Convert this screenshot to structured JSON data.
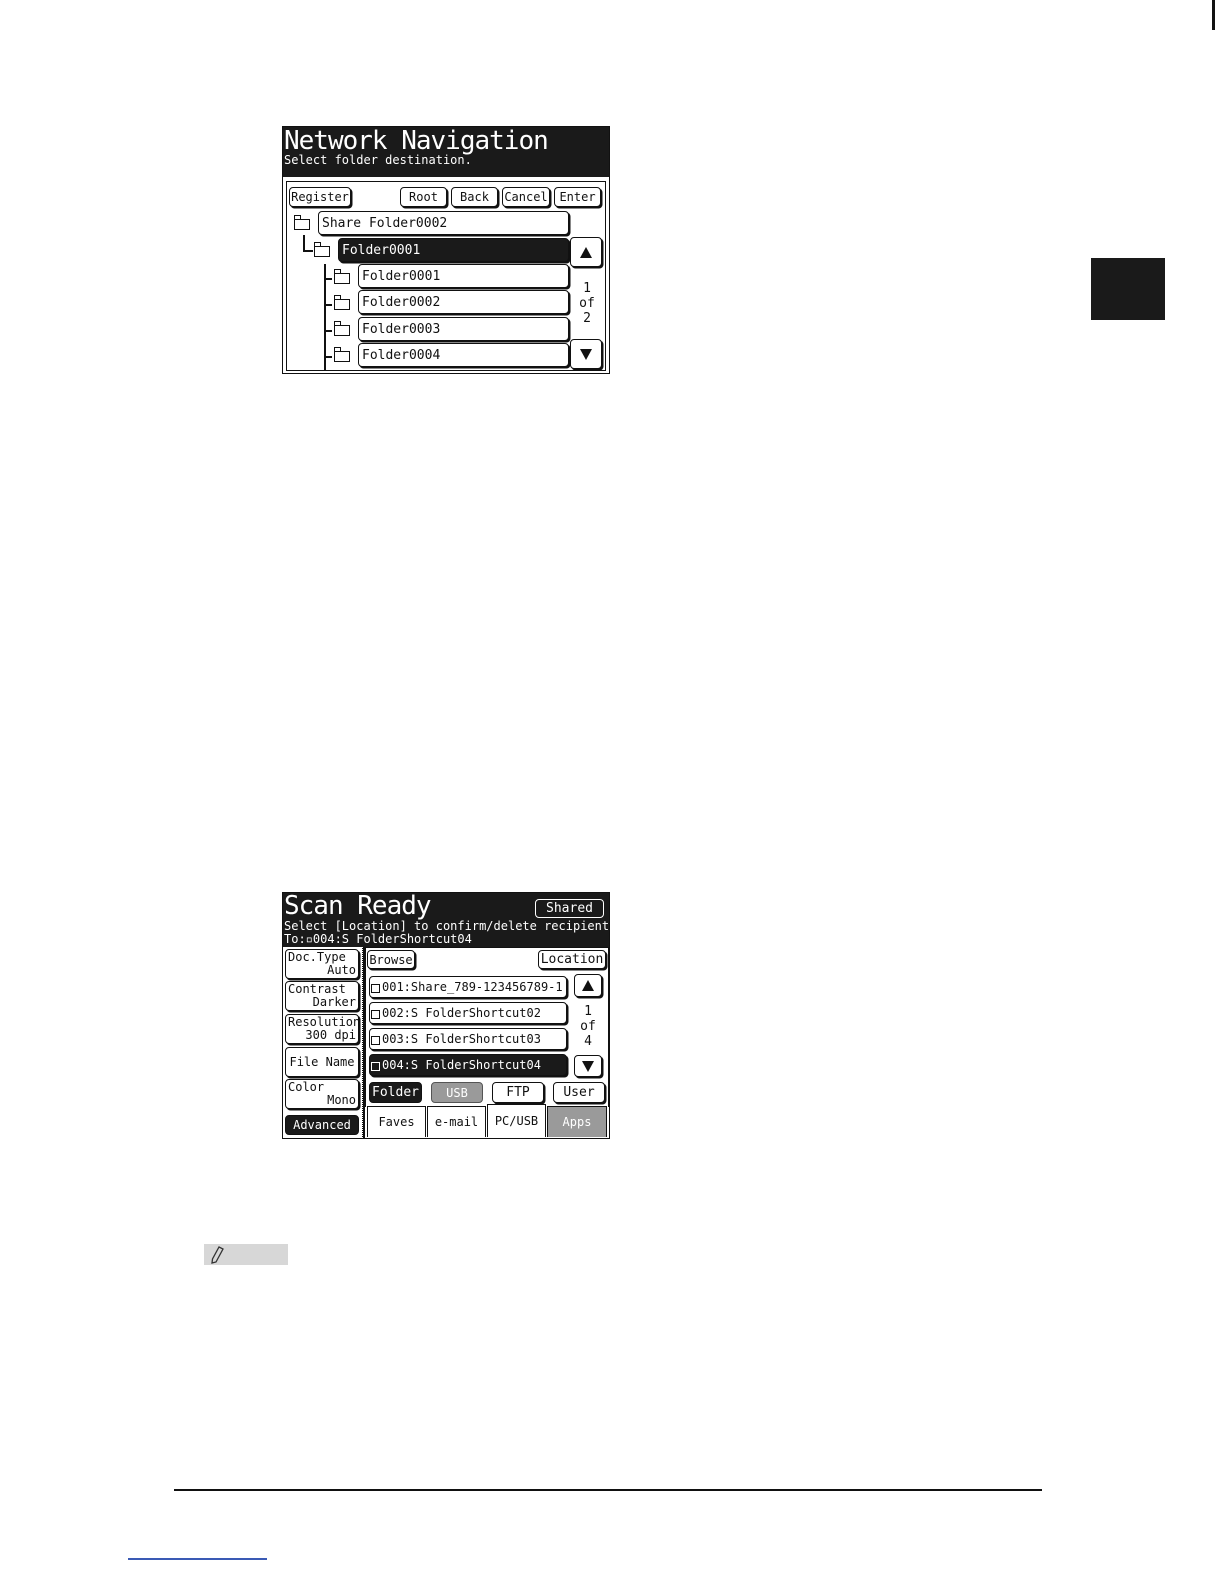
{
  "network_nav": {
    "title": "Network Navigation",
    "subtitle": "Select folder destination.",
    "buttons": {
      "register": "Register",
      "root": "Root",
      "back": "Back",
      "cancel": "Cancel",
      "enter": "Enter"
    },
    "tree": {
      "root": "Share Folder0002",
      "selected": "Folder0001",
      "children": [
        "Folder0001",
        "Folder0002",
        "Folder0003",
        "Folder0004"
      ]
    },
    "page": {
      "current": "1",
      "of": "of",
      "total": "2"
    }
  },
  "scan_ready": {
    "title": "Scan Ready",
    "shared_button": "Shared",
    "instruction": "Select [Location] to confirm/delete recipient",
    "to_line": "To:▫004:S FolderShortcut04",
    "side": [
      {
        "label": "Doc.Type",
        "value": "Auto"
      },
      {
        "label": "Contrast",
        "value": "Darker"
      },
      {
        "label": "Resolution",
        "value": "300 dpi"
      },
      {
        "label": "File Name",
        "value": ""
      },
      {
        "label": "Color",
        "value": "Mono"
      }
    ],
    "advanced": "Advanced",
    "browse": "Browse",
    "location": "Location",
    "list": [
      "001:Share_789-123456789-1",
      "002:S FolderShortcut02",
      "003:S FolderShortcut03",
      "004:S FolderShortcut04"
    ],
    "page": {
      "current": "1",
      "of": "of",
      "total": "4"
    },
    "modes": {
      "folder": "Folder",
      "usb": "USB",
      "ftp": "FTP",
      "user": "User"
    },
    "tabs": {
      "faves": "Faves",
      "email": "e-mail",
      "pcusb": "PC/USB",
      "apps": "Apps"
    }
  },
  "colors": {
    "lcd_dark": "#1a1a1a",
    "chapter_tab": "#1a1a1a",
    "note_bar": "#d7d7d7",
    "rule": "#111111"
  }
}
